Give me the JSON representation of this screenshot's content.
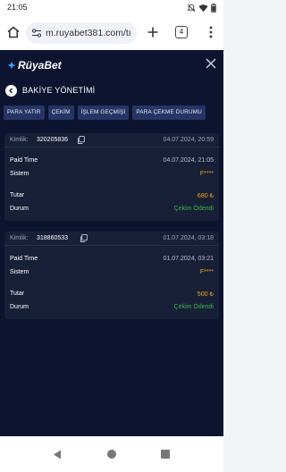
{
  "status": {
    "time": "21:05"
  },
  "browser": {
    "url": "m.ruyabet381.com/tı",
    "tab_count": "4"
  },
  "app": {
    "logo": "RüyaBet",
    "page_title": "BAKİYE YÖNETİMİ",
    "tabs": [
      "PARA YATIR",
      "ÇEKİM",
      "İŞLEM GEÇMİŞİ",
      "PARA ÇEKME DURUMU"
    ]
  },
  "transactions": [
    {
      "id_label": "Kimlik:",
      "id": "320205836",
      "date": "04.07.2024, 20:59",
      "paid_time_label": "Paid Time",
      "paid_time": "04.07.2024, 21:05",
      "system_label": "Sistem",
      "system": "F****",
      "amount_label": "Tutar",
      "amount": "680 ₺",
      "status_label": "Durum",
      "status": "Çekim Ödendi"
    },
    {
      "id_label": "Kimlik:",
      "id": "318860533",
      "date": "01.07.2024, 03:18",
      "paid_time_label": "Paid Time",
      "paid_time": "01.07.2024, 03:21",
      "system_label": "Sistem",
      "system": "F****",
      "amount_label": "Tutar",
      "amount": "500 ₺",
      "status_label": "Durum",
      "status": "Çekim Ödendi"
    }
  ],
  "colors": {
    "background": "#0d1430",
    "card": "#182037",
    "tab": "#253664",
    "amount": "#f0a51f",
    "status_ok": "#34b84a"
  },
  "icons": [
    "notifications-off-icon",
    "wifi-icon",
    "battery-icon",
    "home-icon",
    "site-settings-icon",
    "new-tab-icon",
    "tab-switcher-icon",
    "more-menu-icon",
    "logo-mark-icon",
    "close-icon",
    "back-arrow-icon",
    "copy-icon"
  ]
}
